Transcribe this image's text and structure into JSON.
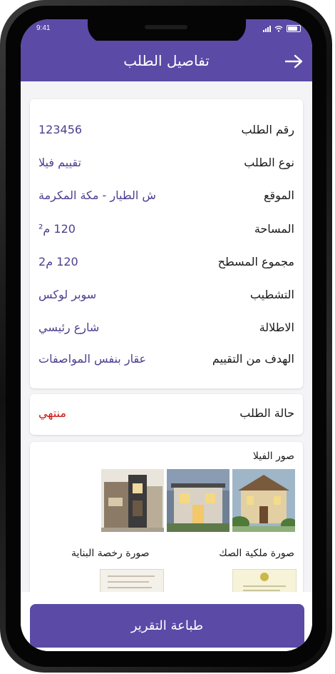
{
  "status_bar": {
    "time": "9:41"
  },
  "app_bar": {
    "title": "تفاصيل الطلب"
  },
  "details": [
    {
      "label": "رقم الطلب",
      "value": "123456"
    },
    {
      "label": "نوع الطلب",
      "value": "تقييم فيلا"
    },
    {
      "label": "الموقع",
      "value": "ش الطيار - مكة المكرمة"
    },
    {
      "label": "المساحة",
      "value": "120 م²"
    },
    {
      "label": "مجموع المسطح",
      "value": "120 م2"
    },
    {
      "label": "التشطيب",
      "value": "سوبر لوكس"
    },
    {
      "label": "الاطلالة",
      "value": "شارع رئيسي"
    },
    {
      "label": "الهدف من التقييم",
      "value": "عقار بنفس المواصفات"
    }
  ],
  "status": {
    "label": "حالة الطلب",
    "value": "منتهي",
    "color": "#cc1616"
  },
  "images": {
    "villa_title": "صور الفيلا",
    "deed_title": "صورة ملكية الصك",
    "permit_title": "صورة رخصة البناية"
  },
  "footer": {
    "print_label": "طباعة التقرير"
  },
  "colors": {
    "primary": "#5b4aa6",
    "value_text": "#4a3f8f"
  }
}
